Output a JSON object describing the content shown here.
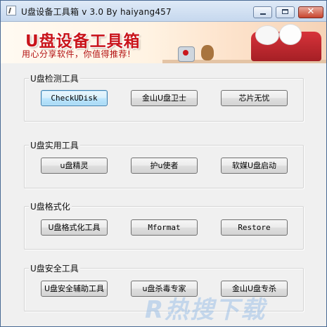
{
  "window": {
    "title": "U盘设备工具箱 v  3.0  By haiyang457",
    "close_glyph": "✕"
  },
  "banner": {
    "title": "U盘设备工具箱",
    "subtitle": "用心分享软件，你值得推荐!"
  },
  "groups": [
    {
      "label": "U盘检测工具",
      "buttons": [
        "CheckUDisk",
        "金山U盘卫士",
        "芯片无忧"
      ]
    },
    {
      "label": "U盘实用工具",
      "buttons": [
        "u盘精灵",
        "护u使者",
        "软媒U盘启动"
      ]
    },
    {
      "label": "U盘格式化",
      "buttons": [
        "U盘格式化工具",
        "Mformat",
        "Restore"
      ]
    },
    {
      "label": "U盘安全工具",
      "buttons": [
        "U盘安全辅助工具",
        "u盘杀毒专家",
        "金山U盘专杀"
      ]
    }
  ],
  "watermark": "R热搜下载",
  "colors": {
    "banner_title": "#c9151b",
    "close_button": "#c7452f",
    "focus_border": "#3c7fb1"
  }
}
